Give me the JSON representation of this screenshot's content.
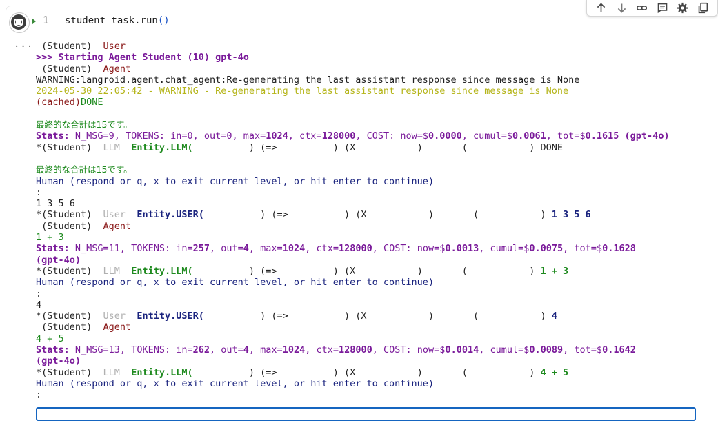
{
  "toolbar": {
    "icons": [
      "arrow-up-icon",
      "arrow-down-icon",
      "link-icon",
      "comment-icon",
      "gear-icon",
      "copy-icon"
    ]
  },
  "cell": {
    "line_number": "1",
    "code": "student_task.run",
    "code_parens": "()",
    "output_menu": "..."
  },
  "output": {
    "l1_a": " (Student)  ",
    "l1_b": "User",
    "l2": ">>> Starting Agent Student (10) gpt-4o",
    "l3_a": " (Student)  ",
    "l3_b": "Agent",
    "l4": "WARNING:langroid.agent.chat_agent:Re-generating the last assistant response since message is None",
    "l5": "2024-05-30 22:05:42 - WARNING - Re-generating the last assistant response since message is None",
    "l6_a": "(cached)",
    "l6_b": "DONE",
    "l8": "最終的な合計は15です。",
    "l9_a": "Stats:",
    "l9_b": " N_MSG=9, TOKENS: in=0, out=0, max=",
    "l9_c": "1024",
    "l9_d": ", ctx=",
    "l9_e": "128000",
    "l9_f": ", COST: now=$",
    "l9_g": "0.0000",
    "l9_h": ", cumul=$",
    "l9_i": "0.0061",
    "l9_j": ", tot=$",
    "l9_k": "0.1615",
    "l9_l": " (gpt-4o)",
    "l10_a": "*(Student)  ",
    "l10_b": "LLM",
    "l10_c": "  Entity.LLM(",
    "l10_d": "          ) (=>          ) (X           )       (           ) DONE",
    "l12": "最終的な合計は15です。",
    "l13": "Human (respond or q, x to exit current level, or hit enter to continue)",
    "l14": ":",
    "l15": "1 3 5 6",
    "l16_a": "*(Student)  ",
    "l16_b": "User",
    "l16_c": "  Entity.USER(",
    "l16_d": "          ) (=>          ) (X           )       (           ) ",
    "l16_e": "1 3 5 6",
    "l17_a": " (Student)  ",
    "l17_b": "Agent",
    "l18": "1 + 3",
    "l19_a": "Stats:",
    "l19_b": " N_MSG=11, TOKENS: in=",
    "l19_c": "257",
    "l19_d": ", out=",
    "l19_e": "4",
    "l19_f": ", max=",
    "l19_g": "1024",
    "l19_h": ", ctx=",
    "l19_i": "128000",
    "l19_j": ", COST: now=$",
    "l19_k": "0.0013",
    "l19_l": ", cumul=$",
    "l19_m": "0.0075",
    "l19_n": ", tot=$",
    "l19_o": "0.1628",
    "l20": "(gpt-4o)",
    "l21_a": "*(Student)  ",
    "l21_b": "LLM",
    "l21_c": "  Entity.LLM(",
    "l21_d": "          ) (=>          ) (X           )       (           ) ",
    "l21_e": "1 + 3",
    "l22": "Human (respond or q, x to exit current level, or hit enter to continue)",
    "l23": ":",
    "l24": "4",
    "l25_a": "*(Student)  ",
    "l25_b": "User",
    "l25_c": "  Entity.USER(",
    "l25_d": "          ) (=>          ) (X           )       (           ) ",
    "l25_e": "4",
    "l26_a": " (Student)  ",
    "l26_b": "Agent",
    "l27": "4 + 5",
    "l28_a": "Stats:",
    "l28_b": " N_MSG=13, TOKENS: in=",
    "l28_c": "262",
    "l28_d": ", out=",
    "l28_e": "4",
    "l28_f": ", max=",
    "l28_g": "1024",
    "l28_h": ", ctx=",
    "l28_i": "128000",
    "l28_j": ", COST: now=$",
    "l28_k": "0.0014",
    "l28_l": ", cumul=$",
    "l28_m": "0.0089",
    "l28_n": ", tot=$",
    "l28_o": "0.1642",
    "l29": "(gpt-4o)",
    "l30_a": "*(Student)  ",
    "l30_b": "LLM",
    "l30_c": "  Entity.LLM(",
    "l30_d": "          ) (=>          ) (X           )       (           ) ",
    "l30_e": "4 + 5",
    "l31": "Human (respond or q, x to exit current level, or hit enter to continue)",
    "l32": ":"
  },
  "input": {
    "value": ""
  },
  "colors": {
    "accent": "#1565c0",
    "purple": "#7a1a9a",
    "green": "#1e8a1e",
    "navy": "#1a237e",
    "darkred": "#8b1a1a",
    "yellow": "#b5b51a"
  }
}
